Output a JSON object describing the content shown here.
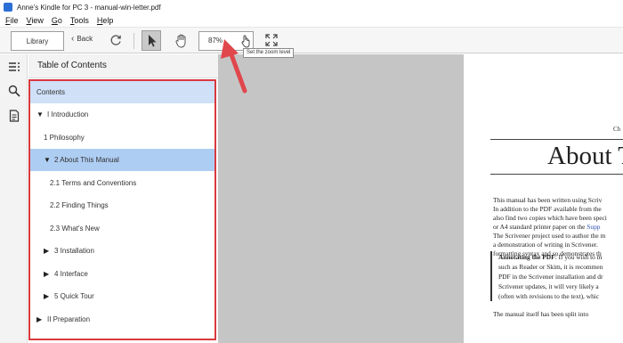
{
  "window": {
    "title": "Anne's Kindle for PC 3 - manual-win-letter.pdf"
  },
  "menu": [
    {
      "first": "F",
      "rest": "ile"
    },
    {
      "first": "V",
      "rest": "iew"
    },
    {
      "first": "G",
      "rest": "o"
    },
    {
      "first": "T",
      "rest": "ools"
    },
    {
      "first": "H",
      "rest": "elp"
    }
  ],
  "toolbar": {
    "library_label": "Library",
    "back_label": "Back",
    "zoom_value": "87%",
    "zoom_tooltip": "Set the zoom level"
  },
  "icons": {
    "app": "kindle-app-icon",
    "toc": "table-of-contents-icon",
    "search": "search-icon",
    "notes": "notes-icon",
    "refresh": "refresh-icon",
    "select": "pointer-select-icon",
    "hand": "hand-pan-icon",
    "fullscreen": "fullscreen-icon"
  },
  "toc": {
    "title": "Table of Contents",
    "items": [
      {
        "label": "Contents",
        "toggle": "",
        "state": "selected"
      },
      {
        "label": "I Introduction",
        "toggle": "▼",
        "state": ""
      },
      {
        "label": "1 Philosophy",
        "toggle": "",
        "state": ""
      },
      {
        "label": "2 About This Manual",
        "toggle": "▼",
        "state": "current"
      },
      {
        "label": "2.1 Terms and Conventions",
        "toggle": "",
        "state": ""
      },
      {
        "label": "2.2 Finding Things",
        "toggle": "",
        "state": ""
      },
      {
        "label": "2.3 What's New",
        "toggle": "",
        "state": ""
      },
      {
        "label": "3 Installation",
        "toggle": "▶",
        "state": ""
      },
      {
        "label": "4 Interface",
        "toggle": "▶",
        "state": ""
      },
      {
        "label": "5 Quick Tour",
        "toggle": "▶",
        "state": ""
      },
      {
        "label": "II Preparation",
        "toggle": "▶",
        "state": ""
      }
    ]
  },
  "page": {
    "running_header": "Ch",
    "heading": "About Th",
    "para1": [
      "This manual has been written using Scriv",
      "In addition to the PDF available from the",
      "also find two copies which have been speci",
      "or A4 standard printer paper on the ",
      "The Scrivener project used to author the m",
      "a demonstration of writing in Scrivener.",
      "formatting syntax and so demonstrates th"
    ],
    "para1_link": "Supp",
    "note_lead": "Annotating the PDF",
    "note_rest": ": If you wish to m",
    "note_lines": [
      "such as Reader or Skim, it is recommen",
      "PDF in the Scrivener installation and dr",
      "Scrivener updates, it will very likely a",
      "(often with revisions to the text), whic"
    ],
    "trailing": "The manual itself has been split into"
  },
  "colors": {
    "highlight_box": "#d9393e",
    "arrow": "#e0474c",
    "selected_row": "#cfe0f7",
    "current_row": "#aecdf2",
    "link": "#2d4fb0"
  }
}
